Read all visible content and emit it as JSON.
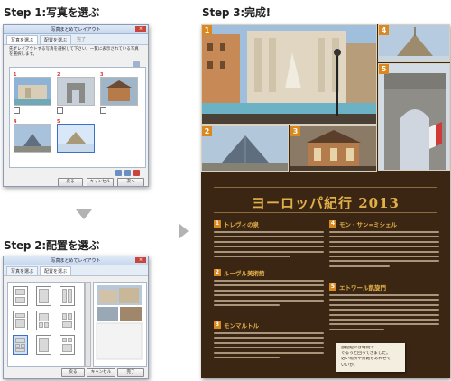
{
  "steps": {
    "step1": "Step 1:写真を選ぶ",
    "step2": "Step 2:配置を選ぶ",
    "step3": "Step 3:完成!"
  },
  "step1_window": {
    "title": "写真まとめてレイアウト",
    "tabs": [
      "写真を選ぶ",
      "配置を選ぶ",
      "完了"
    ],
    "description": "先ずレイアウトする写真を選択して下さい。一覧に表示されている写真を選択します。",
    "photo_numbers": [
      "1",
      "2",
      "3",
      "4",
      "5"
    ],
    "buttons": [
      "戻る",
      "キャンセル",
      "次へ"
    ]
  },
  "step2_window": {
    "title": "写真まとめてレイアウト",
    "tabs": [
      "写真を選ぶ",
      "配置を選ぶ"
    ],
    "buttons": [
      "戻る",
      "キャンセル",
      "完了"
    ]
  },
  "result": {
    "photo_badges": [
      "1",
      "2",
      "3",
      "4",
      "5"
    ],
    "heading": "ヨーロッパ紀行 2013",
    "sections": [
      {
        "num": "1",
        "title": "トレヴィの泉"
      },
      {
        "num": "2",
        "title": "ルーヴル美術館"
      },
      {
        "num": "3",
        "title": "モンマルトル"
      },
      {
        "num": "4",
        "title": "モン・サン=ミシェル"
      },
      {
        "num": "5",
        "title": "エトワール凱旋門"
      }
    ],
    "note_lines": [
      "旅程紹介は時間で",
      "ぐるっと回ってきました。",
      "近い場所や帰路もあわせて",
      "いいか。"
    ]
  },
  "colors": {
    "page_background": "#3b2614",
    "heading": "#e2b04a",
    "badge": "#d9891f"
  }
}
